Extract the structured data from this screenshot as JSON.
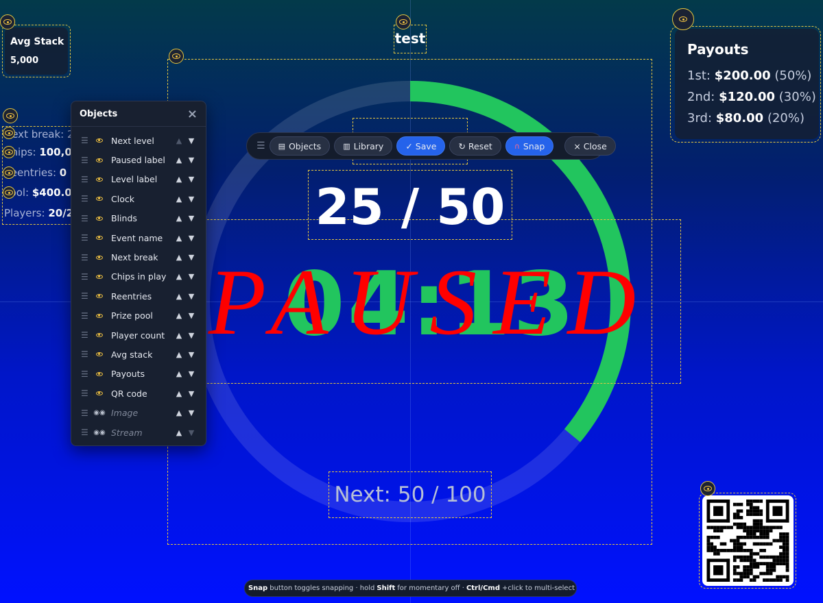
{
  "event_name": "test",
  "avg_stack": {
    "title": "Avg Stack",
    "value": "5,000"
  },
  "left_stats": [
    {
      "label": "Next break: ",
      "value": "2"
    },
    {
      "label": "Chips: ",
      "value": "100,0"
    },
    {
      "label": "Reentries: ",
      "value": "0"
    },
    {
      "label": "Pool: ",
      "value": "$400.0"
    },
    {
      "label": "Players: ",
      "value": "20/2"
    }
  ],
  "blinds": "25 / 50",
  "clock": "04:13",
  "paused_label": "PAUSED",
  "next_level": "Next: 50 / 100",
  "payouts": {
    "title": "Payouts",
    "rows": [
      {
        "place": "1st: ",
        "amount": "$200.00",
        "pct": " (50%)"
      },
      {
        "place": "2nd: ",
        "amount": "$120.00",
        "pct": " (30%)"
      },
      {
        "place": "3rd: ",
        "amount": "$80.00",
        "pct": " (20%)"
      }
    ]
  },
  "ring_progress": 0.36,
  "colors": {
    "ring_fg": "#22c55e",
    "paused": "#ff0000",
    "accent": "#2563eb",
    "dash": "#e8c840"
  },
  "objects_panel": {
    "title": "Objects",
    "close": "×",
    "items": [
      {
        "label": "Next level",
        "visible": true
      },
      {
        "label": "Paused label",
        "visible": true
      },
      {
        "label": "Level label",
        "visible": true
      },
      {
        "label": "Clock",
        "visible": true
      },
      {
        "label": "Blinds",
        "visible": true
      },
      {
        "label": "Event name",
        "visible": true
      },
      {
        "label": "Next break",
        "visible": true
      },
      {
        "label": "Chips in play",
        "visible": true
      },
      {
        "label": "Reentries",
        "visible": true
      },
      {
        "label": "Prize pool",
        "visible": true
      },
      {
        "label": "Player count",
        "visible": true
      },
      {
        "label": "Avg stack",
        "visible": true
      },
      {
        "label": "Payouts",
        "visible": true
      },
      {
        "label": "QR code",
        "visible": true
      },
      {
        "label": "Image",
        "visible": false
      },
      {
        "label": "Stream",
        "visible": false
      }
    ]
  },
  "toolbar": {
    "objects": "Objects",
    "library": "Library",
    "save": "✓ Save",
    "reset": "↻ Reset",
    "snap": "Snap",
    "close": "× Close"
  },
  "hint": {
    "snap": "Snap",
    "t1": "button toggles snapping · hold",
    "shift": "Shift",
    "t2": "for momentary off ·",
    "ctrl": "Ctrl/Cmd",
    "t3": "+click to multi-select"
  },
  "qr_icon": "qr-code"
}
